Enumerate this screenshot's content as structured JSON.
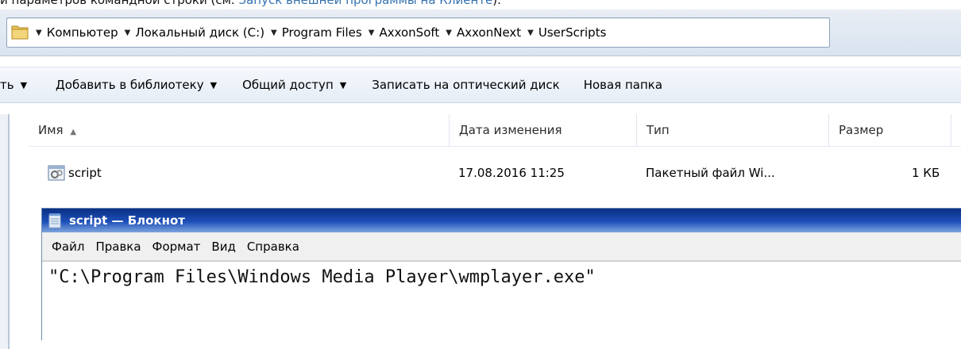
{
  "doc_line": {
    "prefix": "и параметров командной строки (см. ",
    "link": "Запуск внешней программы на Клиенте",
    "suffix": ")."
  },
  "address": {
    "crumbs": [
      "Компьютер",
      "Локальный диск (C:)",
      "Program Files",
      "AxxonSoft",
      "AxxonNext",
      "UserScripts"
    ]
  },
  "toolbar": {
    "cut_left": "ть",
    "add_to_library": "Добавить в библиотеку",
    "share": "Общий доступ",
    "burn": "Записать на оптический диск",
    "new_folder": "Новая папка"
  },
  "columns": {
    "name": "Имя",
    "date": "Дата изменения",
    "type": "Тип",
    "size": "Размер"
  },
  "file": {
    "name": "script",
    "date": "17.08.2016 11:25",
    "type": "Пакетный файл Wi...",
    "size": "1 КБ"
  },
  "notepad": {
    "title": "script — Блокнот",
    "menu": [
      "Файл",
      "Правка",
      "Формат",
      "Вид",
      "Справка"
    ],
    "content": "\"C:\\Program Files\\Windows Media Player\\wmplayer.exe\""
  }
}
